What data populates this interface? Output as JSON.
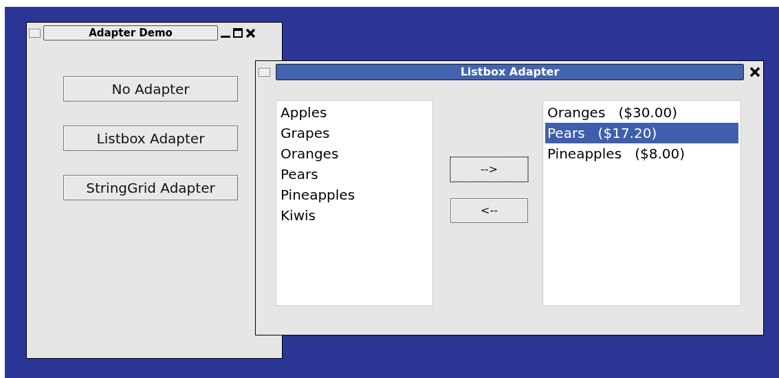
{
  "main_window": {
    "title": "Adapter Demo",
    "buttons": [
      {
        "label": "No Adapter"
      },
      {
        "label": "Listbox Adapter"
      },
      {
        "label": "StringGrid Adapter"
      }
    ]
  },
  "dialog": {
    "title": "Listbox Adapter",
    "source_list": [
      {
        "label": "Apples",
        "selected": false
      },
      {
        "label": "Grapes",
        "selected": false
      },
      {
        "label": "Oranges",
        "selected": false
      },
      {
        "label": "Pears",
        "selected": false
      },
      {
        "label": "Pineapples",
        "selected": false
      },
      {
        "label": "Kiwis",
        "selected": false
      }
    ],
    "move_buttons": [
      {
        "label": "-->",
        "focused": true
      },
      {
        "label": "<--",
        "focused": false
      }
    ],
    "target_list": [
      {
        "label": "Oranges   ($30.00)",
        "selected": false
      },
      {
        "label": "Pears   ($17.20)",
        "selected": true
      },
      {
        "label": "Pineapples   ($8.00)",
        "selected": false
      }
    ]
  }
}
